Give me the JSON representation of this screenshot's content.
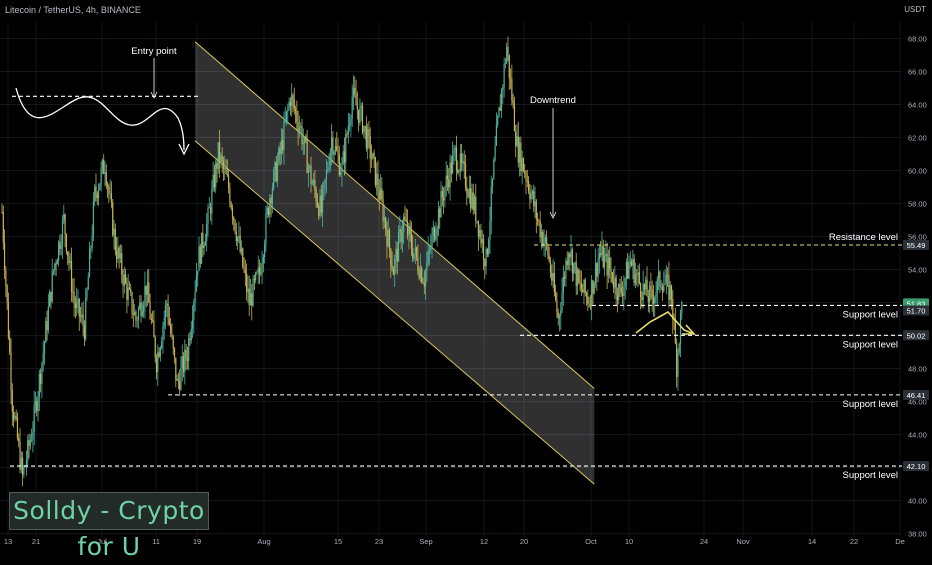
{
  "header": {
    "symbol_line": "Litecoin / TetherUS, 4h, BINANCE",
    "unit": "USDT"
  },
  "watermark": "Solldy - Crypto for U",
  "colors": {
    "background": "#000000",
    "candle_up": "#4fb3a2",
    "candle_down": "#c6b254",
    "channel_border": "#d9c95a",
    "level_line": "#ffffff",
    "support_line": "#dfe08a",
    "annotation": "#ffffff",
    "arrow": "#e8e06a",
    "price_tag_bg": "#2b2f36"
  },
  "chart_data": {
    "type": "candlestick",
    "interval": "4h",
    "x_tick_labels": [
      "13",
      "21",
      "Jul",
      "11",
      "19",
      "Aug",
      "15",
      "23",
      "Sep",
      "12",
      "20",
      "Oct",
      "10",
      "24",
      "Nov",
      "14",
      "22",
      "De"
    ],
    "y_axis": {
      "ylim": [
        37.8,
        69.0
      ],
      "tick_values": [
        38,
        40,
        42,
        44,
        46,
        48,
        50,
        52,
        54,
        56,
        58,
        60,
        62,
        64,
        66,
        68
      ],
      "tick_labels": [
        "38.00",
        "40.00",
        "42.00",
        "44.00",
        "46.00",
        "48.00",
        "50.00",
        "52.00",
        "54.00",
        "56.00",
        "58.00",
        "60.00",
        "62.00",
        "64.00",
        "66.00",
        "68.00"
      ]
    },
    "price_path": [
      [
        0,
        57.5
      ],
      [
        2,
        46.0
      ],
      [
        4,
        41.4
      ],
      [
        6,
        44.5
      ],
      [
        8,
        49.0
      ],
      [
        10,
        54.0
      ],
      [
        12,
        57.0
      ],
      [
        14,
        52.0
      ],
      [
        16,
        50.5
      ],
      [
        18,
        58.5
      ],
      [
        20,
        60.5
      ],
      [
        22,
        55.5
      ],
      [
        24,
        53.0
      ],
      [
        26,
        51.0
      ],
      [
        28,
        53.0
      ],
      [
        30,
        48.5
      ],
      [
        32,
        52.0
      ],
      [
        34,
        47.0
      ],
      [
        36,
        49.0
      ],
      [
        38,
        54.5
      ],
      [
        40,
        57.0
      ],
      [
        42,
        61.0
      ],
      [
        44,
        59.0
      ],
      [
        46,
        55.5
      ],
      [
        48,
        52.0
      ],
      [
        50,
        53.8
      ],
      [
        52,
        58.5
      ],
      [
        54,
        61.0
      ],
      [
        56,
        64.5
      ],
      [
        58,
        62.5
      ],
      [
        60,
        59.5
      ],
      [
        62,
        57.5
      ],
      [
        64,
        62.0
      ],
      [
        66,
        60.0
      ],
      [
        68,
        64.5
      ],
      [
        70,
        63.0
      ],
      [
        72,
        60.5
      ],
      [
        74,
        57.5
      ],
      [
        76,
        54.0
      ],
      [
        78,
        57.0
      ],
      [
        80,
        55.0
      ],
      [
        82,
        53.5
      ],
      [
        84,
        56.5
      ],
      [
        86,
        59.0
      ],
      [
        88,
        61.0
      ],
      [
        90,
        59.5
      ],
      [
        92,
        57.5
      ],
      [
        94,
        54.5
      ],
      [
        96,
        62.0
      ],
      [
        98,
        67.5
      ],
      [
        100,
        61.5
      ],
      [
        102,
        59.5
      ],
      [
        104,
        57.0
      ],
      [
        106,
        55.0
      ],
      [
        108,
        51.0
      ],
      [
        110,
        55.5
      ],
      [
        112,
        53.0
      ],
      [
        114,
        52.2
      ],
      [
        116,
        55.0
      ],
      [
        118,
        54.0
      ],
      [
        120,
        52.5
      ],
      [
        122,
        54.5
      ],
      [
        124,
        53.0
      ],
      [
        126,
        52.2
      ],
      [
        128,
        53.5
      ],
      [
        130,
        52.5
      ],
      [
        131,
        48.3
      ],
      [
        132,
        51.8
      ]
    ],
    "price_tags": [
      {
        "value": 55.49,
        "label": "55.49"
      },
      {
        "value": 51.83,
        "label": "51.83"
      },
      {
        "value": 51.7,
        "label": "51.70"
      },
      {
        "value": 50.02,
        "label": "50.02"
      },
      {
        "value": 46.41,
        "label": "46.41"
      },
      {
        "value": 42.1,
        "label": "42.10"
      }
    ],
    "levels": [
      {
        "value": 64.5,
        "style": "dashed-white"
      },
      {
        "value": 55.49,
        "style": "dashed-yellow",
        "label": "Resistance level"
      },
      {
        "value": 51.83,
        "style": "dashed-white",
        "label": "Support level"
      },
      {
        "value": 50.02,
        "style": "dashed-white",
        "label": "Support level"
      },
      {
        "value": 46.41,
        "style": "dashed-white",
        "label": "Support level"
      },
      {
        "value": 42.1,
        "style": "dashed-white",
        "label": "Support level"
      }
    ],
    "channel": {
      "upper": [
        [
          37.5,
          67.8
        ],
        [
          115,
          46.8
        ]
      ],
      "lower": [
        [
          37.5,
          61.8
        ],
        [
          115,
          41.0
        ]
      ]
    },
    "annotations": [
      {
        "text": "Entry point"
      },
      {
        "text": "Downtrend"
      }
    ]
  }
}
